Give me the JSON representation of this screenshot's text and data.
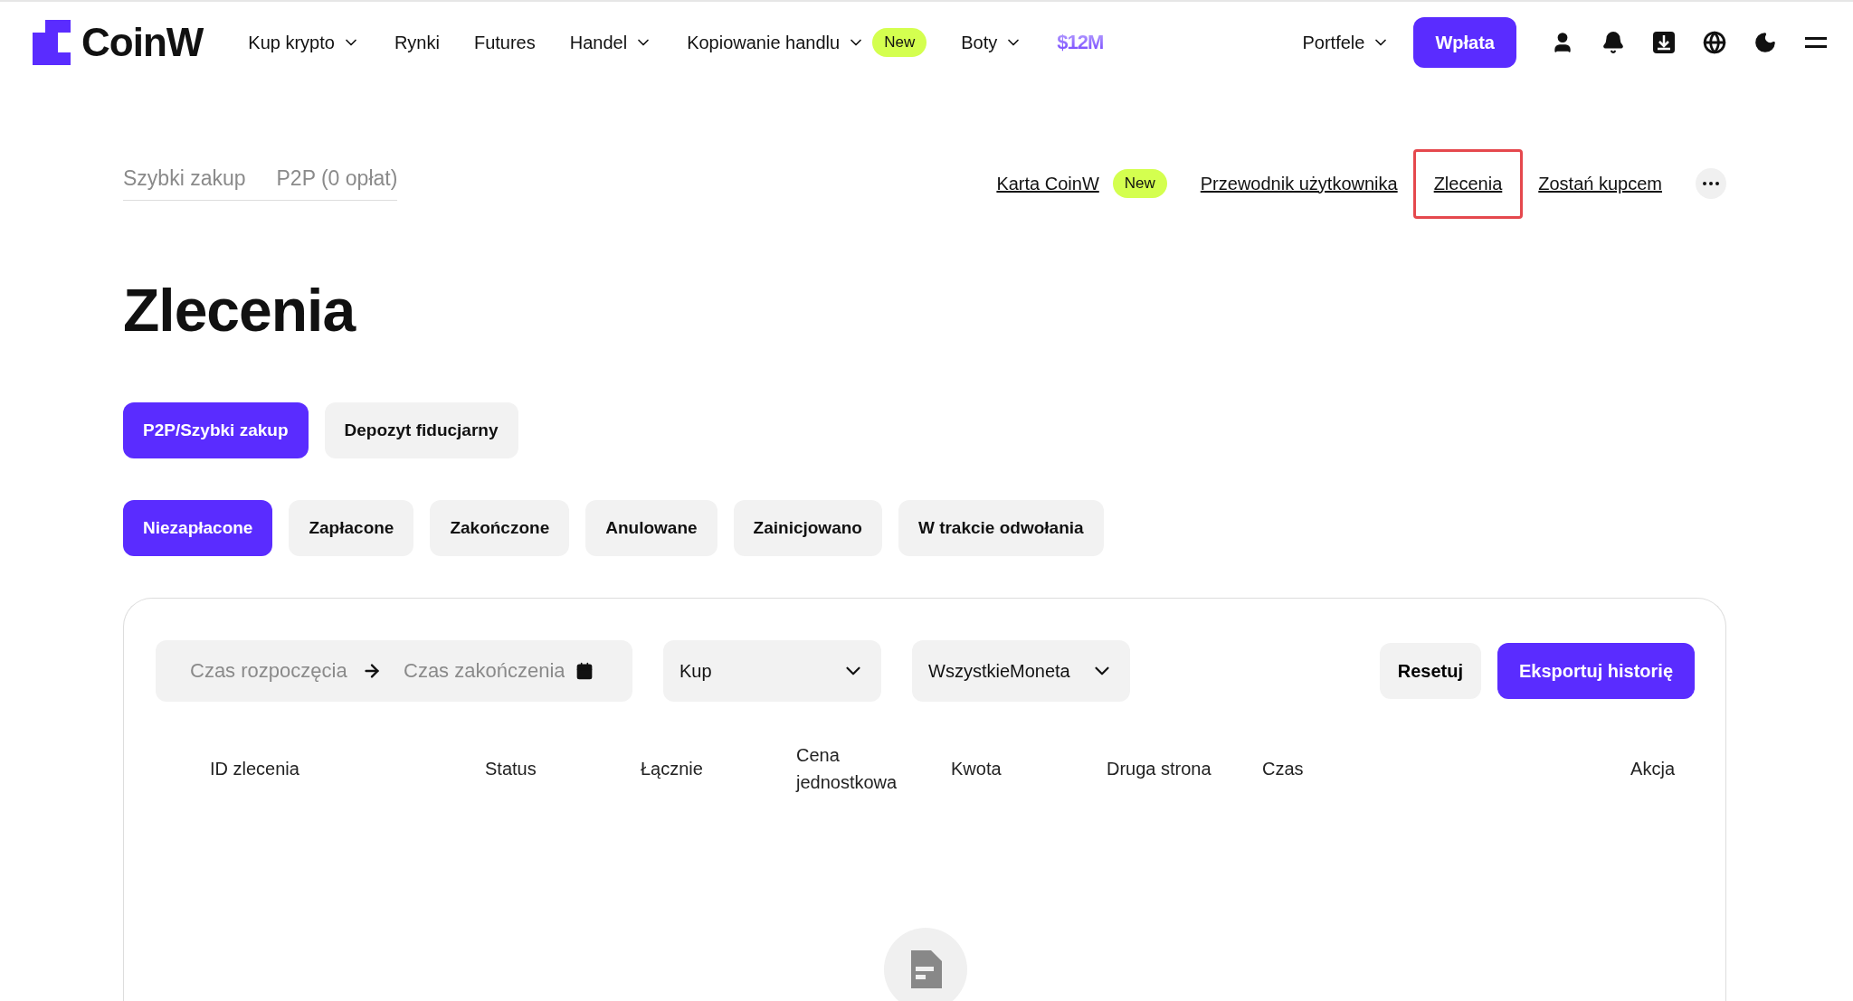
{
  "header": {
    "logo": "CoinW",
    "nav": [
      {
        "label": "Kup krypto",
        "dropdown": true
      },
      {
        "label": "Rynki",
        "dropdown": false
      },
      {
        "label": "Futures",
        "dropdown": false
      },
      {
        "label": "Handel",
        "dropdown": true
      },
      {
        "label": "Kopiowanie handlu",
        "dropdown": true,
        "badge": "New"
      },
      {
        "label": "Boty",
        "dropdown": true
      }
    ],
    "promo": "$12M",
    "wallets": "Portfele",
    "deposit": "Wpłata"
  },
  "subnav": {
    "tabs": [
      {
        "label": "Szybki zakup"
      },
      {
        "label": "P2P (0 opłat)"
      }
    ],
    "links": [
      {
        "label": "Karta CoinW",
        "badge": "New",
        "highlighted": false
      },
      {
        "label": "Przewodnik użytkownika",
        "highlighted": false
      },
      {
        "label": "Zlecenia",
        "highlighted": true
      },
      {
        "label": "Zostań kupcem",
        "highlighted": false
      }
    ]
  },
  "page_title": "Zlecenia",
  "categories": [
    {
      "label": "P2P/Szybki zakup",
      "selected": true
    },
    {
      "label": "Depozyt fiducjarny",
      "selected": false
    }
  ],
  "statuses": [
    {
      "label": "Niezapłacone",
      "selected": true
    },
    {
      "label": "Zapłacone",
      "selected": false
    },
    {
      "label": "Zakończone",
      "selected": false
    },
    {
      "label": "Anulowane",
      "selected": false
    },
    {
      "label": "Zainicjowano",
      "selected": false
    },
    {
      "label": "W trakcie odwołania",
      "selected": false
    }
  ],
  "filters": {
    "start_placeholder": "Czas rozpoczęcia",
    "end_placeholder": "Czas zakończenia",
    "side": "Kup",
    "coin": "WszystkieMoneta",
    "reset": "Resetuj",
    "export": "Eksportuj historię"
  },
  "table": {
    "columns": [
      "ID zlecenia",
      "Status",
      "Łącznie",
      "Cena jednostkowa",
      "Kwota",
      "Druga strona",
      "Czas",
      "Akcja"
    ]
  }
}
